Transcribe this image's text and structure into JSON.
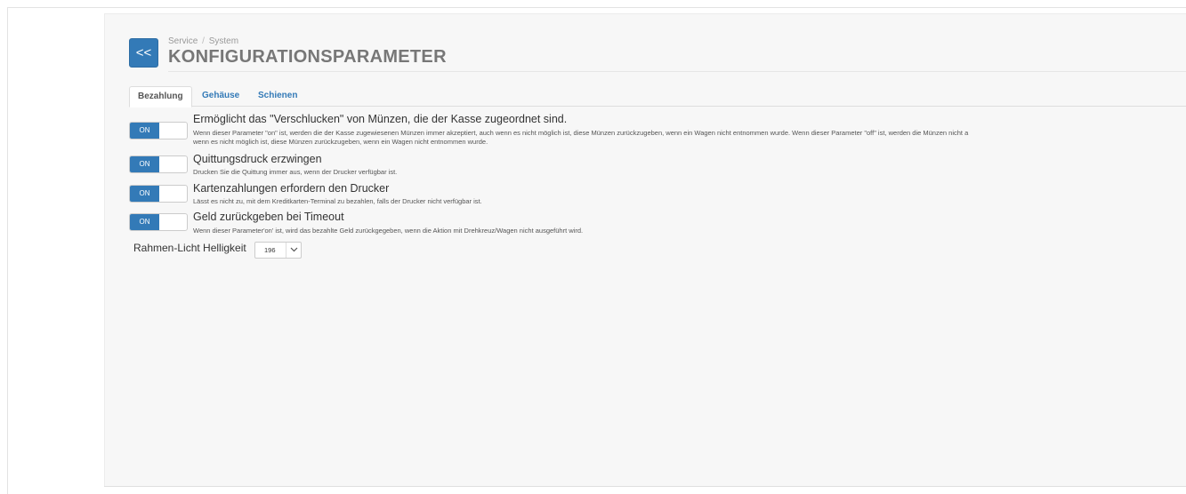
{
  "header": {
    "back_label": "<<",
    "breadcrumb_parent": "Service",
    "breadcrumb_separator": "/",
    "breadcrumb_current": "System",
    "title": "KONFIGURATIONSPARAMETER"
  },
  "tabs": [
    {
      "label": "Bezahlung",
      "active": true
    },
    {
      "label": "Gehäuse",
      "active": false
    },
    {
      "label": "Schienen",
      "active": false
    }
  ],
  "settings": [
    {
      "toggle": "ON",
      "title": "Ermöglicht das \"Verschlucken\" von Münzen, die der Kasse zugeordnet sind.",
      "desc_line1": "Wenn dieser Parameter \"on\" ist, werden die der Kasse zugewiesenen Münzen immer akzeptiert, auch wenn es nicht möglich ist, diese Münzen zurückzugeben, wenn ein Wagen nicht entnommen wurde. Wenn dieser Parameter \"off\" ist, werden die Münzen nicht a",
      "desc_line2": "wenn es nicht möglich ist, diese Münzen zurückzugeben, wenn ein Wagen nicht entnommen wurde."
    },
    {
      "toggle": "ON",
      "title": "Quittungsdruck erzwingen",
      "desc_line1": "Drucken Sie die Quittung immer aus, wenn der Drucker verfügbar ist."
    },
    {
      "toggle": "ON",
      "title": "Kartenzahlungen erfordern den Drucker",
      "desc_line1": "Lässt es nicht zu, mit dem Kreditkarten-Terminal zu bezahlen, falls der Drucker nicht verfügbar ist."
    },
    {
      "toggle": "ON",
      "title": "Geld zurückgeben bei Timeout",
      "desc_line1": "Wenn dieser Parameter'on' ist, wird das bezahlte Geld zurückgegeben, wenn die Aktion mit Drehkreuz/Wagen nicht ausgeführt wird."
    }
  ],
  "brightness": {
    "label": "Rahmen-Licht Helligkeit",
    "value": "196"
  },
  "colors": {
    "accent": "#337ab7",
    "panel_bg": "#f7f7f7"
  }
}
